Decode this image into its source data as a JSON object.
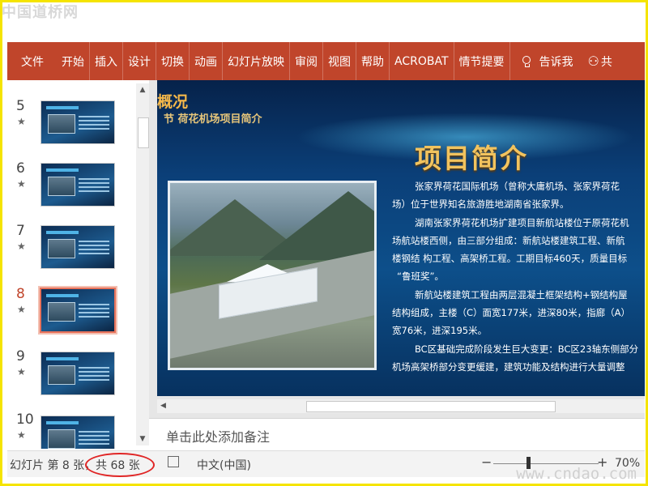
{
  "watermark": {
    "top": "中国道桥网",
    "bottom": "www.cndao.com"
  },
  "ribbon": {
    "tabs": [
      "文件",
      "开始",
      "插入",
      "设计",
      "切换",
      "动画",
      "幻灯片放映",
      "审阅",
      "视图",
      "帮助",
      "ACROBAT",
      "情节提要"
    ],
    "tell_me": "告诉我",
    "share_partial": "共"
  },
  "thumbnails": [
    {
      "number": "5",
      "star": "★",
      "active": false
    },
    {
      "number": "6",
      "star": "★",
      "active": false
    },
    {
      "number": "7",
      "star": "★",
      "active": false
    },
    {
      "number": "8",
      "star": "★",
      "active": true
    },
    {
      "number": "9",
      "star": "★",
      "active": false
    },
    {
      "number": "10",
      "star": "★",
      "active": false
    }
  ],
  "slide": {
    "chapter_title": "章\n概况",
    "chapter_title_visible": "概况",
    "section_subtitle": "节 荷花机场项目简介",
    "heading": "项目简介",
    "paragraphs": [
      "张家界荷花国际机场（曾称大庸机场、张家界荷花",
      "场）位于世界知名旅游胜地湖南省张家界。",
      "湖南张家界荷花机场扩建项目新航站楼位于原荷花机",
      "场航站楼西侧，由三部分组成：新航站楼建筑工程、新航",
      "楼钢结 构工程、高架桥工程。工期目标460天，质量目标",
      "“鲁班奖”。",
      "新航站楼建筑工程由两层混凝土框架结构+钢结构屋",
      "结构组成，主楼（C）面宽177米，进深80米，指廊（A）",
      "宽76米，进深195米。",
      "BC区基础完成阶段发生巨大变更：BC区23轴东侧部分",
      "机场高架桥部分变更缓建，建筑功能及结构进行大量调整"
    ]
  },
  "notes_placeholder": "单击此处添加备注",
  "status_bar": {
    "slide_info": "幻灯片 第 8 张，",
    "total": "共 68 张",
    "language": "中文(中国)",
    "zoom_minus": "−",
    "zoom_plus": "+",
    "zoom": "70%"
  },
  "colors": {
    "ribbon": "#c0452b",
    "highlight_circle": "#e02525",
    "frame": "#f5e400"
  }
}
